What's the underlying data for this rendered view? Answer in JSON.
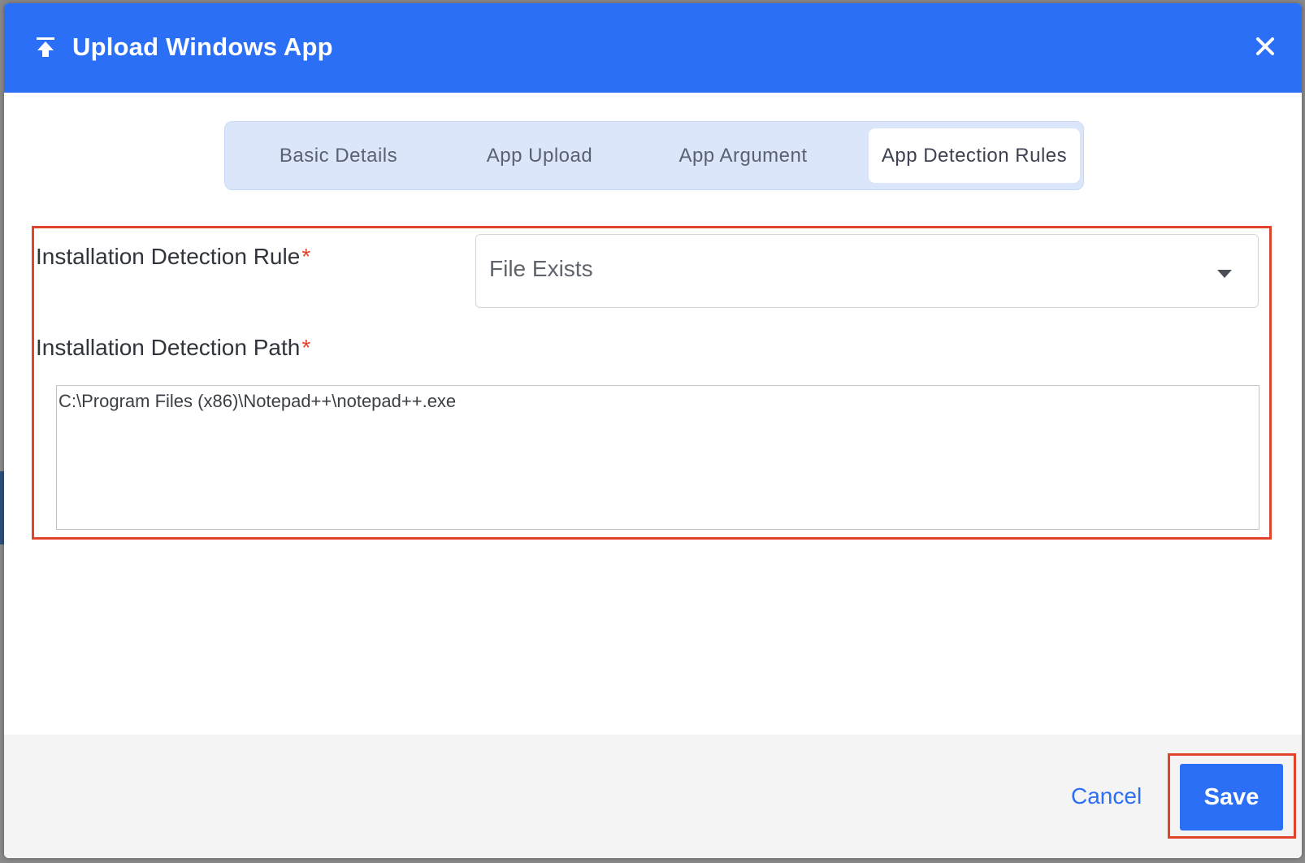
{
  "dialog": {
    "title": "Upload Windows App",
    "icons": {
      "header": "upload-icon",
      "close": "close-icon",
      "select": "chevron-down-icon"
    }
  },
  "tabs": [
    {
      "label": "Basic Details",
      "active": false
    },
    {
      "label": "App Upload",
      "active": false
    },
    {
      "label": "App Argument",
      "active": false
    },
    {
      "label": "App Detection Rules",
      "active": true
    }
  ],
  "form": {
    "rule_label": "Installation Detection Rule",
    "rule_value": "File Exists",
    "path_label": "Installation Detection Path",
    "path_value": "C:\\Program Files (x86)\\Notepad++\\notepad++.exe",
    "required_marker": "*"
  },
  "footer": {
    "cancel_label": "Cancel",
    "save_label": "Save"
  },
  "colors": {
    "accent": "#2a6ff5",
    "highlight": "#e2432b",
    "tab_bar": "#dce6fb"
  }
}
